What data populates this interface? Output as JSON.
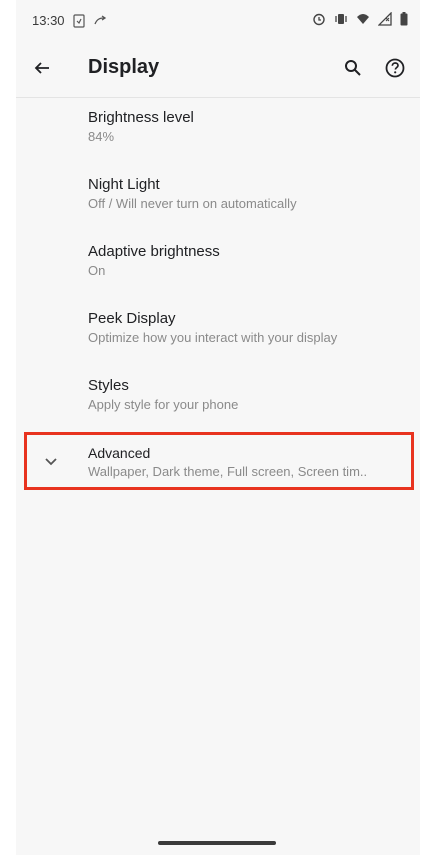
{
  "status_bar": {
    "time": "13:30",
    "icons": [
      "screenshot-icon",
      "call-forward-icon",
      "alarm-icon",
      "vibrate-icon",
      "wifi-icon",
      "signal-icon",
      "battery-icon"
    ]
  },
  "app_bar": {
    "title": "Display",
    "back_icon": "arrow-back-icon",
    "search_icon": "search-icon",
    "help_icon": "help-icon"
  },
  "settings": {
    "items": [
      {
        "title": "Brightness level",
        "summary": "84%"
      },
      {
        "title": "Night Light",
        "summary": "Off / Will never turn on automatically"
      },
      {
        "title": "Adaptive brightness",
        "summary": "On"
      },
      {
        "title": "Peek Display",
        "summary": "Optimize how you interact with your display"
      },
      {
        "title": "Styles",
        "summary": "Apply style for your phone"
      }
    ],
    "advanced": {
      "title": "Advanced",
      "summary": "Wallpaper, Dark theme, Full screen, Screen tim..",
      "icon": "chevron-down-icon"
    }
  },
  "colors": {
    "highlight": "#e8331f",
    "background": "#f7f7f7",
    "text_primary": "#202124",
    "text_secondary": "#8a8a8a"
  }
}
